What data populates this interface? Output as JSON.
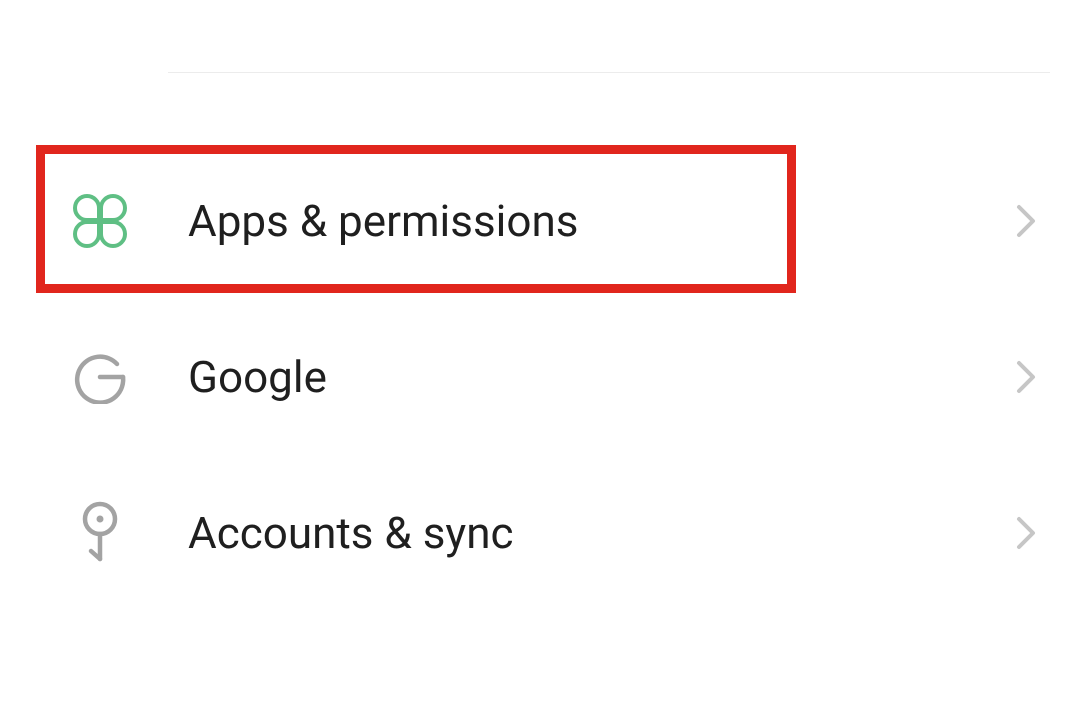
{
  "settings": {
    "items": [
      {
        "id": "apps-permissions",
        "label": "Apps & permissions",
        "icon": "apps-icon",
        "icon_color": "#5fbf84",
        "highlighted": true
      },
      {
        "id": "google",
        "label": "Google",
        "icon": "google-icon",
        "icon_color": "#a3a3a3",
        "highlighted": false
      },
      {
        "id": "accounts-sync",
        "label": "Accounts & sync",
        "icon": "key-icon",
        "icon_color": "#a3a3a3",
        "highlighted": false
      }
    ],
    "highlight_color": "#e1261d"
  }
}
